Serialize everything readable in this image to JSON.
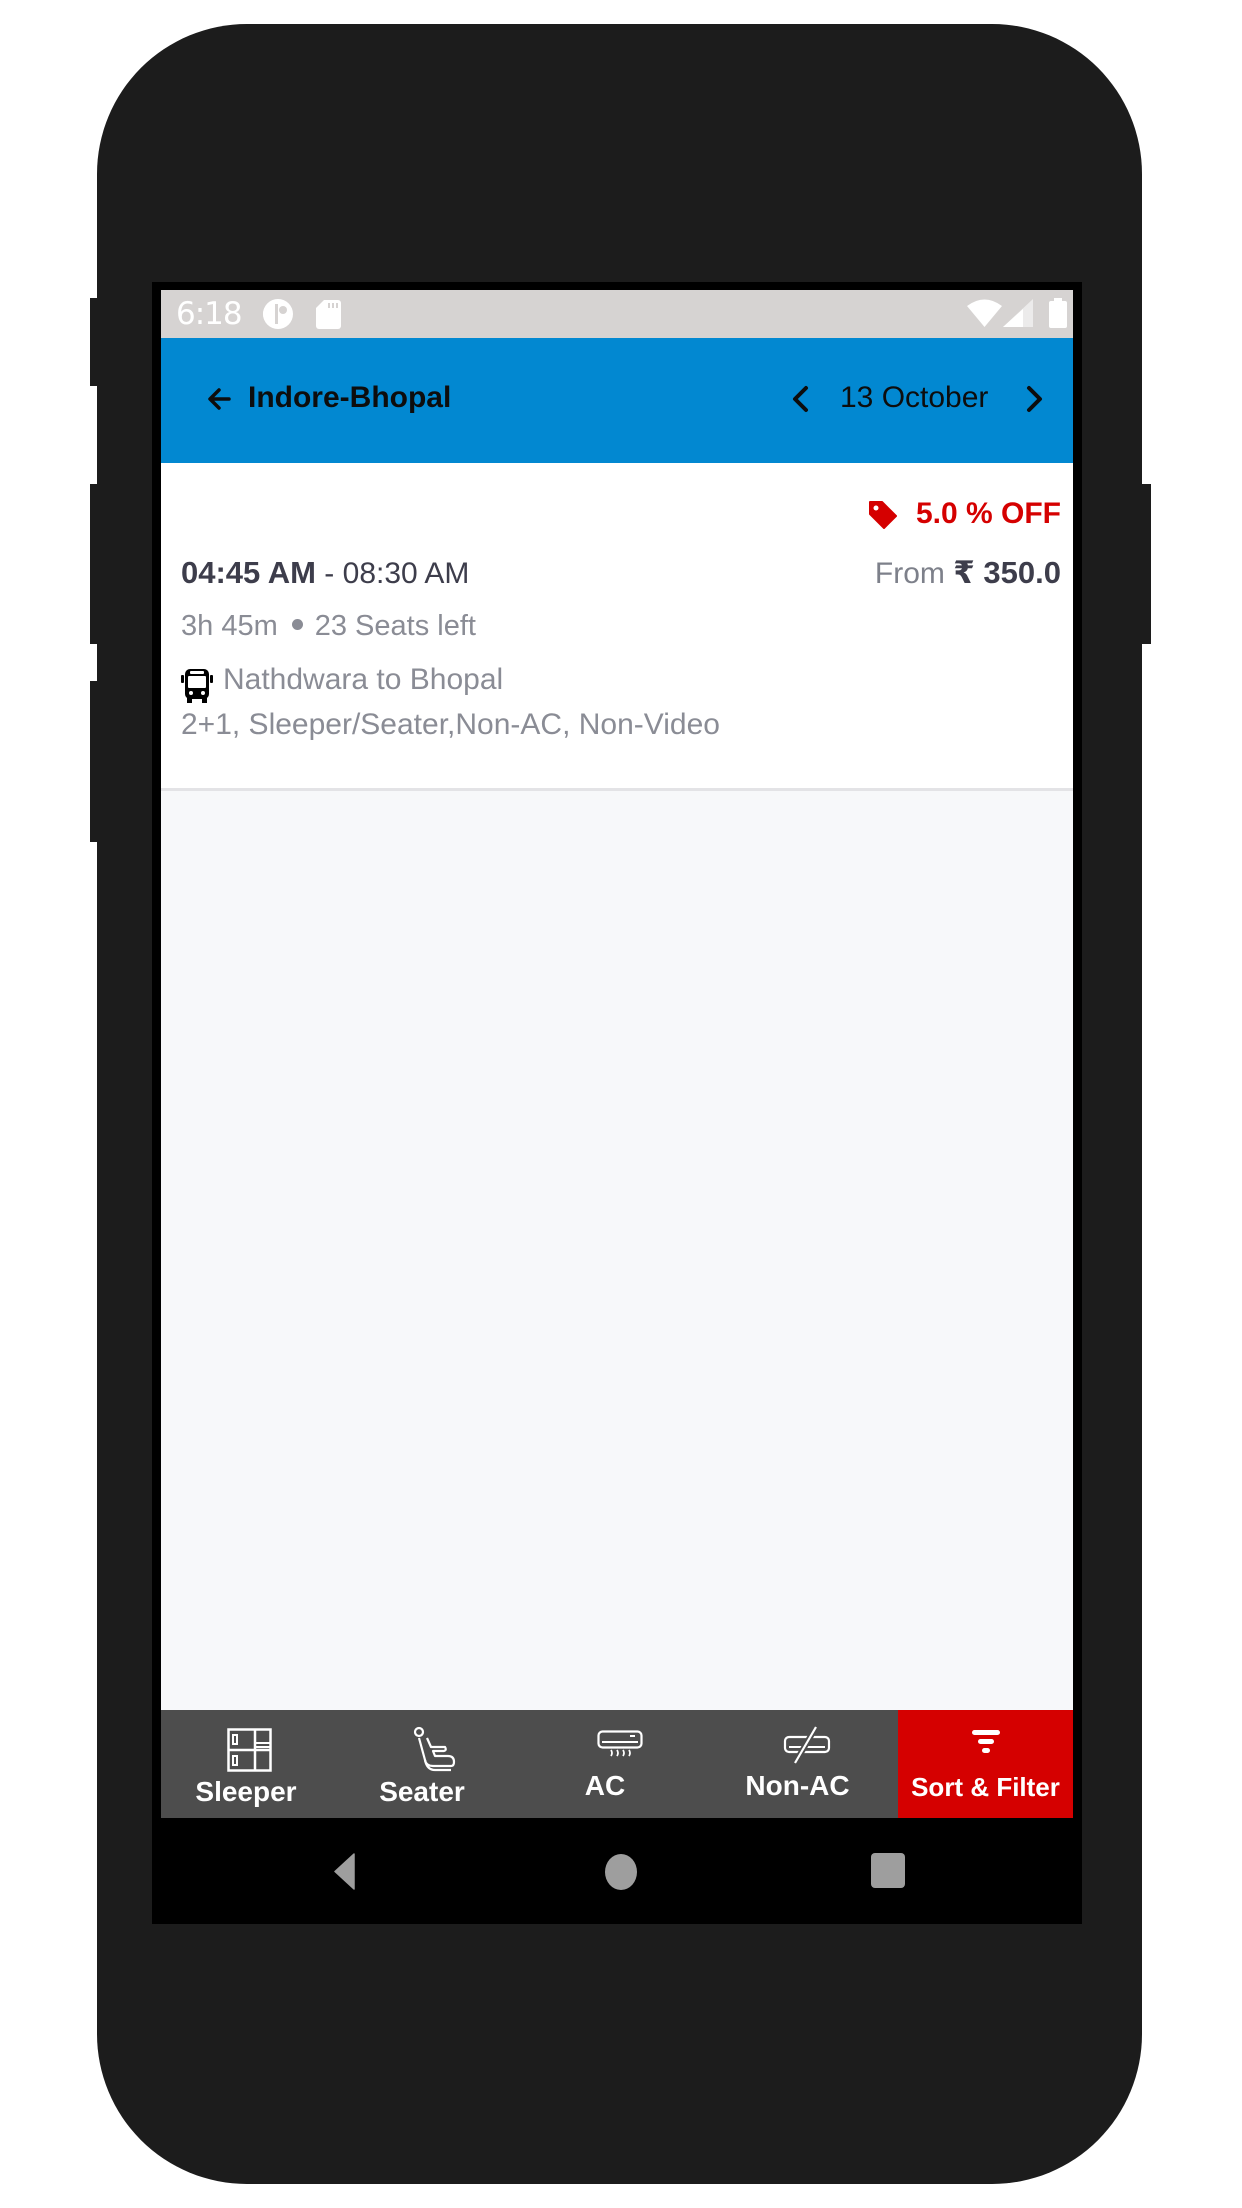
{
  "status_bar": {
    "time": "6:18",
    "icons": [
      "data-saver-icon",
      "sd-card-icon",
      "wifi-icon",
      "cell-signal-icon",
      "battery-icon"
    ]
  },
  "header": {
    "back_icon": "arrow-left-icon",
    "title": "Indore-Bhopal",
    "prev_date_icon": "chevron-left-icon",
    "date": "13 October",
    "next_date_icon": "chevron-right-icon"
  },
  "results": [
    {
      "discount_icon": "tag-icon",
      "discount": "5.0 % OFF",
      "departure": "04:45 AM",
      "separator": " - ",
      "arrival": "08:30 AM",
      "price_prefix": "From",
      "price": "₹ 350.0",
      "duration": "3h 45m",
      "seats_left": "23 Seats left",
      "operator_icon": "bus-icon",
      "route": "Nathdwara to Bhopal",
      "amenities": "2+1, Sleeper/Seater,Non-AC, Non-Video"
    }
  ],
  "tab_bar": {
    "tabs": [
      {
        "label": "Sleeper",
        "icon": "sleeper-berth-icon"
      },
      {
        "label": "Seater",
        "icon": "seat-icon"
      },
      {
        "label": "AC",
        "icon": "air-conditioner-icon"
      },
      {
        "label": "Non-AC",
        "icon": "no-ac-icon"
      },
      {
        "label": "Sort & Filter",
        "icon": "filter-icon"
      }
    ]
  },
  "colors": {
    "header_bg": "#0288d1",
    "accent_red": "#d50000",
    "tab_bar_bg": "#4d4d4d",
    "status_bar_bg": "#d6d3d2"
  }
}
